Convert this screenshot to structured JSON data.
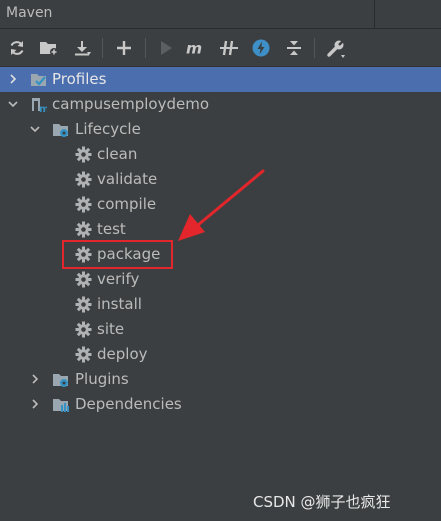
{
  "window": {
    "title": "Maven"
  },
  "toolbar": {
    "buttons": [
      "reload-icon",
      "add-maven-project-icon",
      "download-icon",
      "plus-icon",
      "run-icon",
      "execute-goal-icon",
      "toggle-offline-icon",
      "skip-tests-icon",
      "collapse-all-icon",
      "settings-wrench-icon"
    ]
  },
  "tree": {
    "profiles": "Profiles",
    "project": "campusemploydemo",
    "lifecycle": "Lifecycle",
    "goals": [
      "clean",
      "validate",
      "compile",
      "test",
      "package",
      "verify",
      "install",
      "site",
      "deploy"
    ],
    "plugins": "Plugins",
    "dependencies": "Dependencies"
  },
  "colors": {
    "panel_bg": "#3c3f41",
    "selection": "#4b6eaf",
    "annotation_red": "#e2262b",
    "folder_blue": "#7fa8c9"
  },
  "watermark": "CSDN @狮子也疯狂"
}
